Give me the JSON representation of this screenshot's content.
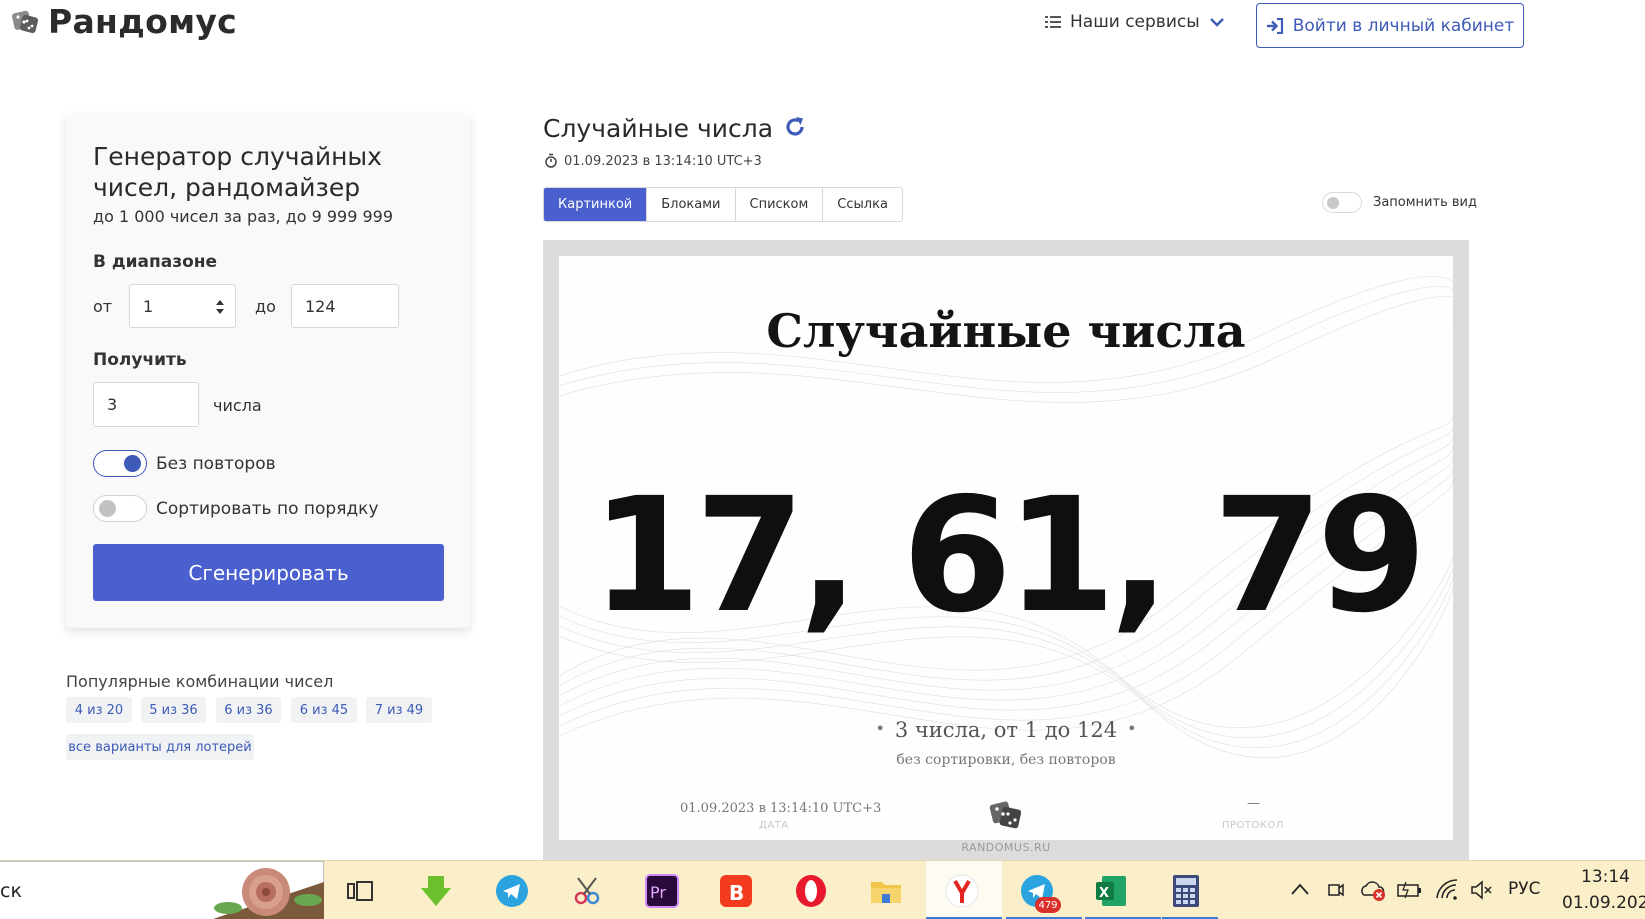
{
  "header": {
    "logo_text": "Рандомус",
    "services_label": "Наши сервисы",
    "login_label": "Войти в личный кабинет"
  },
  "generator": {
    "title": "Генератор случайных чисел, рандомайзер",
    "subtitle": "до 1 000 чисел за раз, до 9 999 999",
    "range_label": "В диапазоне",
    "from_label": "от",
    "from_value": "1",
    "to_label": "до",
    "to_value": "124",
    "get_label": "Получить",
    "count_value": "3",
    "count_unit": "числа",
    "no_repeat_label": "Без повторов",
    "no_repeat_on": true,
    "sort_label": "Сортировать по порядку",
    "sort_on": false,
    "generate_label": "Сгенерировать"
  },
  "popular": {
    "title": "Популярные комбинации чисел",
    "chips": [
      "4 из 20",
      "5 из 36",
      "6 из 36",
      "6 из 45",
      "7 из 49"
    ],
    "all_lotteries": "все варианты для лотерей"
  },
  "result": {
    "title": "Случайные числа",
    "datetime": "01.09.2023 в 13:14:10 UTC+3",
    "tabs": [
      "Картинкой",
      "Блоками",
      "Списком",
      "Ссылка"
    ],
    "active_tab": "Картинкой",
    "remember_label": "Запомнить вид",
    "image": {
      "title": "Случайные числа",
      "numbers": "17, 61, 79",
      "summary": "3 числа, от 1 до 124",
      "sub": "без сортировки, без повторов",
      "date": "01.09.2023 в 13:14:10 UTC+3",
      "date_caption": "ДАТА",
      "protocol_value": "—",
      "protocol_caption": "ПРОТОКОЛ",
      "site": "RANDOMUS.RU"
    }
  },
  "taskbar": {
    "search_text": "ск",
    "telegram_badge": "479",
    "tray_lang": "РУС",
    "clock_time": "13:14",
    "clock_date": "01.09.2023"
  },
  "colors": {
    "accent": "#4a60cf",
    "link": "#3d5bb7",
    "taskbar": "#fbefc9"
  }
}
